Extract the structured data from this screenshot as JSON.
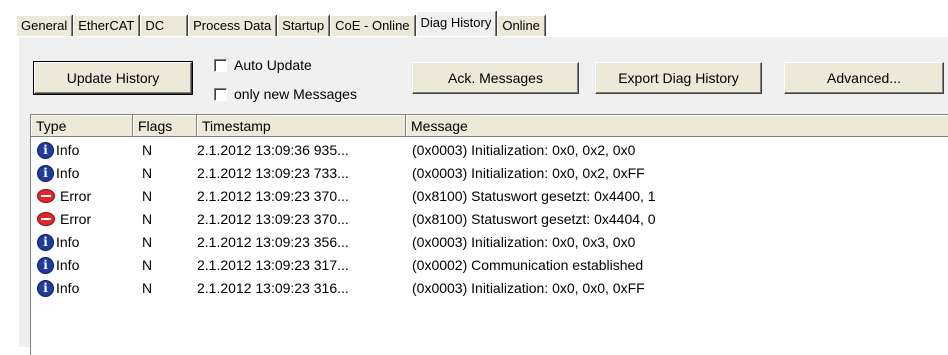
{
  "tabs": [
    {
      "label": "General"
    },
    {
      "label": "EtherCAT"
    },
    {
      "label": "DC"
    },
    {
      "label": "Process Data"
    },
    {
      "label": "Startup"
    },
    {
      "label": "CoE - Online"
    },
    {
      "label": "Diag History",
      "active": true
    },
    {
      "label": "Online"
    }
  ],
  "toolbar": {
    "update_history": "Update History",
    "auto_update": "Auto Update",
    "only_new_messages": "only new Messages",
    "ack_messages": "Ack. Messages",
    "export_diag_history": "Export Diag History",
    "advanced": "Advanced..."
  },
  "table": {
    "columns": [
      "Type",
      "Flags",
      "Timestamp",
      "Message"
    ],
    "rows": [
      {
        "type": "Info",
        "icon": "info-icon",
        "flags": "N",
        "timestamp": "2.1.2012 13:09:36 935...",
        "message": "(0x0003) Initialization: 0x0, 0x2, 0x0"
      },
      {
        "type": "Info",
        "icon": "info-icon",
        "flags": "N",
        "timestamp": "2.1.2012 13:09:23 733...",
        "message": "(0x0003) Initialization: 0x0, 0x2, 0xFF"
      },
      {
        "type": "Error",
        "icon": "error-icon",
        "flags": "N",
        "timestamp": "2.1.2012 13:09:23 370...",
        "message": "(0x8100) Statuswort gesetzt: 0x4400, 1"
      },
      {
        "type": "Error",
        "icon": "error-icon",
        "flags": "N",
        "timestamp": "2.1.2012 13:09:23 370...",
        "message": "(0x8100) Statuswort gesetzt: 0x4404, 0"
      },
      {
        "type": "Info",
        "icon": "info-icon",
        "flags": "N",
        "timestamp": "2.1.2012 13:09:23 356...",
        "message": "(0x0003) Initialization: 0x0, 0x3, 0x0"
      },
      {
        "type": "Info",
        "icon": "info-icon",
        "flags": "N",
        "timestamp": "2.1.2012 13:09:23 317...",
        "message": "(0x0002) Communication established"
      },
      {
        "type": "Info",
        "icon": "info-icon",
        "flags": "N",
        "timestamp": "2.1.2012 13:09:23 316...",
        "message": "(0x0003) Initialization: 0x0, 0x0, 0xFF"
      }
    ]
  }
}
